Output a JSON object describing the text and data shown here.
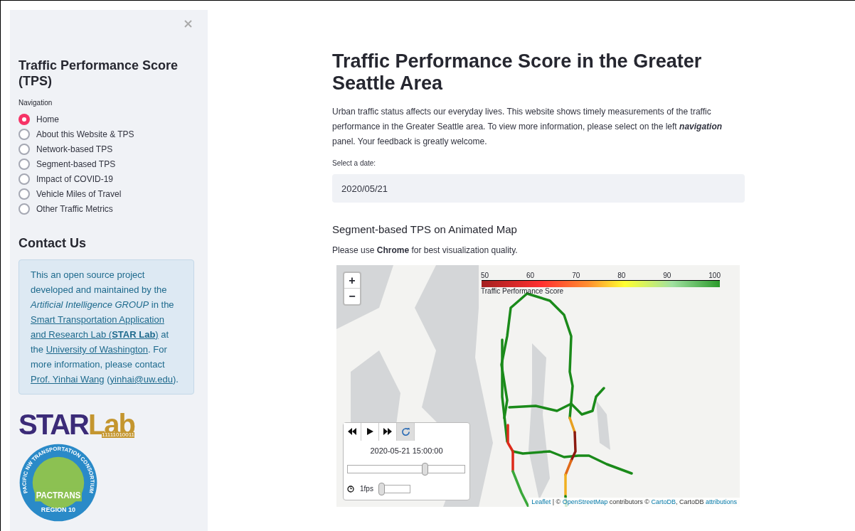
{
  "sidebar": {
    "title": "Traffic Performance Score (TPS)",
    "nav_label": "Navigation",
    "nav_items": [
      {
        "label": "Home",
        "selected": true
      },
      {
        "label": "About this Website & TPS",
        "selected": false
      },
      {
        "label": "Network-based TPS",
        "selected": false
      },
      {
        "label": "Segment-based TPS",
        "selected": false
      },
      {
        "label": "Impact of COVID-19",
        "selected": false
      },
      {
        "label": "Vehicle Miles of Travel",
        "selected": false
      },
      {
        "label": "Other Traffic Metrics",
        "selected": false
      }
    ],
    "contact_title": "Contact Us",
    "contact": [
      {
        "kind": "text",
        "text": "This an open source project developed and maintained by the"
      },
      {
        "kind": "italic",
        "text": "Artificial Intelligence GROUP"
      },
      {
        "kind": "text",
        "text": "in the"
      },
      {
        "kind": "link",
        "text": "Smart Transportation Application"
      },
      {
        "kind": "link",
        "text": "and Research Lab (**STAR Lab**)"
      },
      {
        "kind": "text",
        "text": "at the"
      },
      {
        "kind": "link",
        "text": "University of Washington"
      },
      {
        "kind": "text",
        "text": ". For more information, please contact"
      },
      {
        "kind": "link",
        "text": "Prof. Yinhai Wang"
      },
      {
        "kind": "text",
        "text": "("
      },
      {
        "kind": "link",
        "text": "yinhai@uw.edu"
      },
      {
        "kind": "text",
        "text": ")."
      }
    ],
    "starlab_logo": {
      "parts": [
        "STAR",
        "Lab"
      ],
      "code": "11111010011"
    },
    "pactrans_logo": {
      "ring": "PACIFIC NW TRANSPORTATION CONSORTIUM",
      "name": "PACTRANS",
      "region": "REGION 10"
    }
  },
  "main": {
    "title": "Traffic Performance Score in the Greater Seattle Area",
    "intro": "Urban traffic status affects our everyday lives. This website shows timely measurements of the traffic performance in the Greater Seattle area. To view more information, please select on the left *navigation* panel. Your feedback is greatly welcome.",
    "date_label": "Select a date:",
    "date_value": "2020/05/21",
    "section_title": "Segment-based TPS on Animated Map",
    "note": "Please use **Chrome** for best visualization quality.",
    "map": {
      "zoom_buttons": [
        "+",
        "−"
      ],
      "legend": {
        "ticks": [
          "50",
          "60",
          "70",
          "80",
          "90",
          "100"
        ],
        "caption": "Traffic Performance Score"
      },
      "player": {
        "buttons": [
          {
            "kind": "rewind",
            "selected": false
          },
          {
            "kind": "play",
            "selected": false
          },
          {
            "kind": "forward",
            "selected": false
          },
          {
            "kind": "loop",
            "selected": true
          }
        ],
        "timestamp": "2020-05-21 15:00:00",
        "time_slider": {
          "level": 0.66
        },
        "fps_label": "1fps",
        "fps_slider": {
          "level": 0.05
        }
      },
      "attribution": [
        {
          "kind": "link",
          "text": "Leaflet"
        },
        {
          "kind": "text",
          "text": "| ©"
        },
        {
          "kind": "link",
          "text": "OpenStreetMap"
        },
        {
          "kind": "text",
          "text": "contributors ©"
        },
        {
          "kind": "link",
          "text": "CartoDB"
        },
        {
          "kind": "text",
          "text": ", CartoDB"
        },
        {
          "kind": "link",
          "text": "attributions"
        }
      ]
    }
  }
}
